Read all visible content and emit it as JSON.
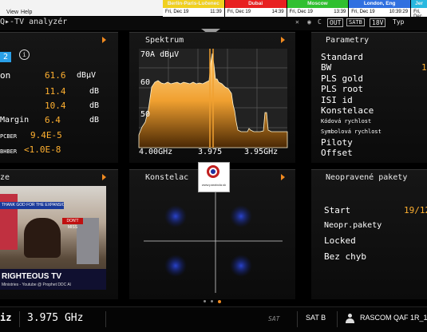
{
  "menu": {
    "items": [
      "View",
      "Help"
    ]
  },
  "clocks": [
    {
      "city": "Berlin-Paris-Lučenec",
      "date": "Fri, Dec 19",
      "time": "11:39",
      "color": "#f0d020",
      "text": "#000"
    },
    {
      "city": "Dubai",
      "date": "Fri, Dec 19",
      "time": "14:39",
      "color": "#e82020",
      "text": "#000"
    },
    {
      "city": "Moscow",
      "date": "Fri, Dec 19",
      "time": "13:39",
      "color": "#30c030",
      "text": "#000"
    },
    {
      "city": "London, Eng",
      "date": "Fri, Dec 19",
      "time": "10:39:29",
      "color": "#3070e0",
      "text": "#fff"
    },
    {
      "city": "Jer",
      "date": "Fri, Dec",
      "time": "",
      "color": "#28b8e0",
      "text": "#000"
    }
  ],
  "app": {
    "title": "Q▸-TV analyzér",
    "status1": "OUT",
    "status2": "SATB",
    "status3": "18V",
    "status4": "Typ"
  },
  "measure": {
    "badge": "2",
    "rows": [
      {
        "label": "on",
        "value": "61.6",
        "unit": "dBµV"
      },
      {
        "label": "",
        "value": "11.4",
        "unit": "dB"
      },
      {
        "label": "",
        "value": "10.4",
        "unit": "dB"
      },
      {
        "label": "Margin",
        "value": "6.4",
        "unit": "dB"
      },
      {
        "label": "PCBER",
        "value": "9.4E-5",
        "unit": ""
      },
      {
        "label": "BHBER",
        "value": "<1.0E-8",
        "unit": ""
      }
    ]
  },
  "spectrum": {
    "title": "Spektrum",
    "ref": "70A dBµV",
    "g60": "60",
    "g50": "50",
    "fl": "4.00GHz",
    "fc": "3.975",
    "fr": "3.95GHz"
  },
  "params": {
    "title": "Parametry",
    "rows": [
      {
        "label": "Standard",
        "small": false,
        "value": ""
      },
      {
        "label": "BW",
        "small": false,
        "value": "1"
      },
      {
        "label": "PLS gold",
        "small": false,
        "value": ""
      },
      {
        "label": "PLS root",
        "small": false,
        "value": ""
      },
      {
        "label": "ISI id",
        "small": false,
        "value": ""
      },
      {
        "label": "Konstelace",
        "small": false,
        "value": ""
      },
      {
        "label": "Kódová rychlost",
        "small": true,
        "value": ""
      },
      {
        "label": "Symbolová rychlost",
        "small": true,
        "value": ""
      },
      {
        "label": "Piloty",
        "small": false,
        "value": ""
      },
      {
        "label": "Offset",
        "small": false,
        "value": ""
      }
    ]
  },
  "video": {
    "title": "ze",
    "banner1": "THANK GOD FOR THE EXPANSION",
    "dont_miss": "DON'T MISS",
    "channel": "RIGHTEOUS TV",
    "ticker": "Ministries - Youtube @ Prophet DDC Al"
  },
  "constellation": {
    "title": "Konstelac"
  },
  "errors": {
    "title": "Neopravené pakety",
    "rows": [
      {
        "label": "Start",
        "value": "19/12"
      },
      {
        "label": "Neopr.pakety",
        "value": ""
      },
      {
        "label": "Locked",
        "value": ""
      },
      {
        "label": "Bez chyb",
        "value": ""
      }
    ]
  },
  "watermark": {
    "text": "www.parabola.sk"
  },
  "bottom": {
    "left": "iz",
    "freq": "3.975 GHz",
    "sat_logo": "SAT",
    "sat": "SAT B",
    "user": "RASCOM QAF 1R_1"
  },
  "colors": {
    "accent": "#f08a20",
    "value": "#ffb030"
  }
}
